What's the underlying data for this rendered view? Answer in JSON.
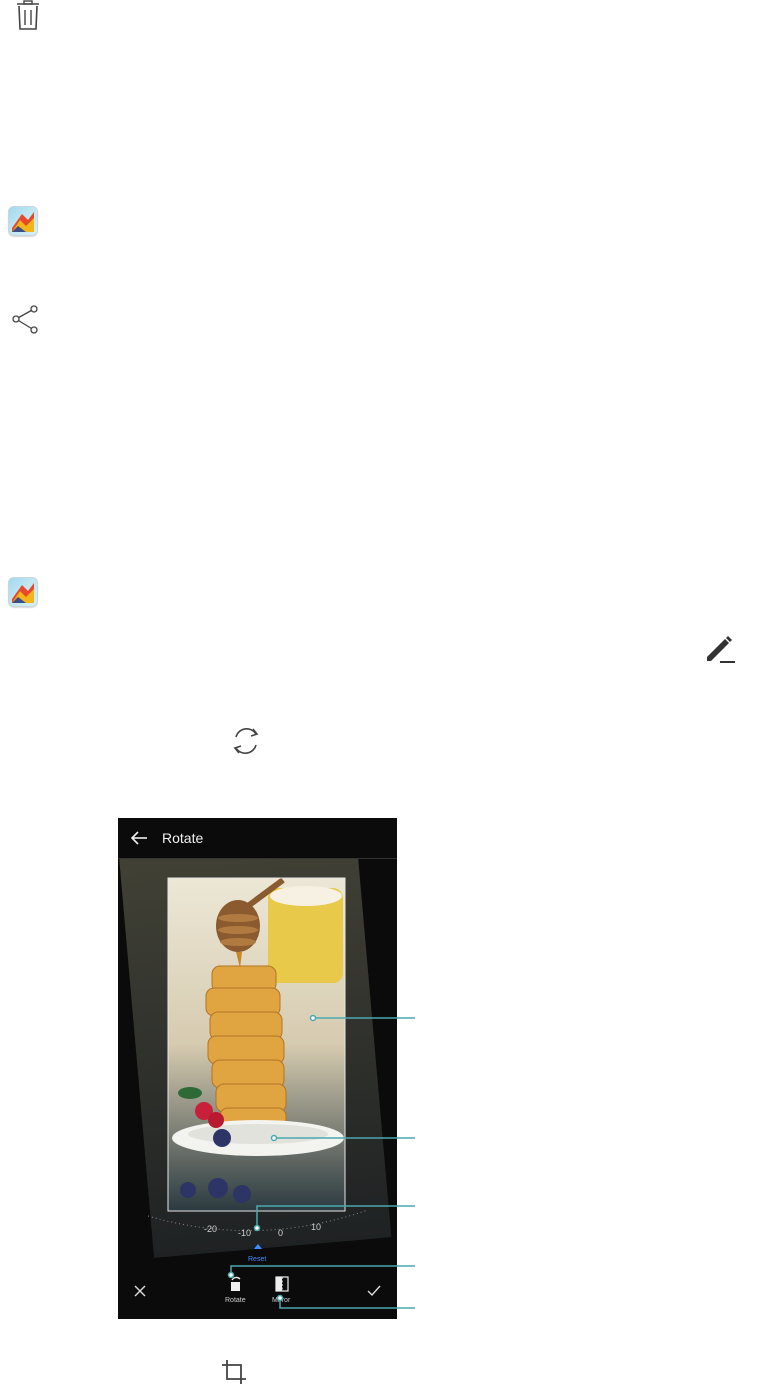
{
  "icons": {
    "trash": "trash-icon",
    "gallery": "gallery-app-icon",
    "share": "share-icon",
    "edit": "pencil-edit-icon",
    "rotate": "rotate-refresh-icon",
    "crop": "crop-icon"
  },
  "phone": {
    "title": "Rotate",
    "dial_ticks": [
      "-20",
      "-10",
      "0",
      "10"
    ],
    "reset_label": "Reset",
    "rotate_label": "Rotate",
    "mirror_label": "Mirror"
  },
  "colors": {
    "callout_line": "#4aa8b0",
    "reset_accent": "#3d8cff",
    "phone_bg": "#0b0b0b"
  }
}
